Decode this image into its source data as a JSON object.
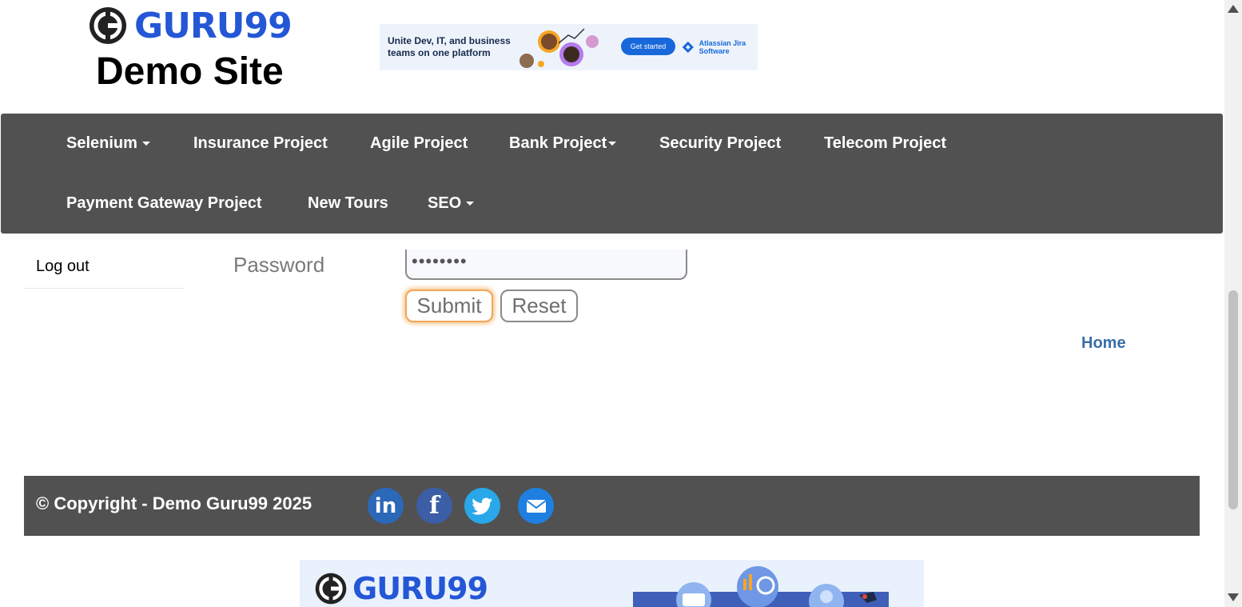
{
  "header": {
    "logo_text": "GURU99",
    "site_title": "Demo Site",
    "ad_banner": {
      "text": "Unite Dev, IT, and business teams on one platform",
      "cta": "Get started",
      "brand": "Atlassian Jira Software"
    }
  },
  "nav": {
    "items": [
      {
        "label": "Selenium",
        "dropdown": true
      },
      {
        "label": "Insurance Project",
        "dropdown": false
      },
      {
        "label": "Agile Project",
        "dropdown": false
      },
      {
        "label": "Bank Project",
        "dropdown": true
      },
      {
        "label": "Security Project",
        "dropdown": false
      },
      {
        "label": "Telecom Project",
        "dropdown": false
      },
      {
        "label": "Payment Gateway Project",
        "dropdown": false
      },
      {
        "label": "New Tours",
        "dropdown": false
      },
      {
        "label": "SEO",
        "dropdown": true
      }
    ]
  },
  "sidebar": {
    "logout_label": "Log out"
  },
  "form": {
    "password_label": "Password",
    "password_value": "••••••••",
    "submit_label": "Submit",
    "reset_label": "Reset"
  },
  "home_link": "Home",
  "footer": {
    "copyright": "© Copyright - Demo Guru99 2025",
    "social": [
      {
        "icon": "linkedin-icon",
        "glyph": "in"
      },
      {
        "icon": "facebook-icon",
        "glyph": "f"
      },
      {
        "icon": "twitter-icon",
        "glyph": "🐦"
      },
      {
        "icon": "email-icon",
        "glyph": "✉"
      }
    ]
  },
  "bottom_banner": {
    "logo_text": "GURU99"
  },
  "colors": {
    "nav_bg": "#515151",
    "brand_blue": "#2457d6",
    "link_blue": "#3a6ea5",
    "submit_focus": "#f0a65a"
  }
}
